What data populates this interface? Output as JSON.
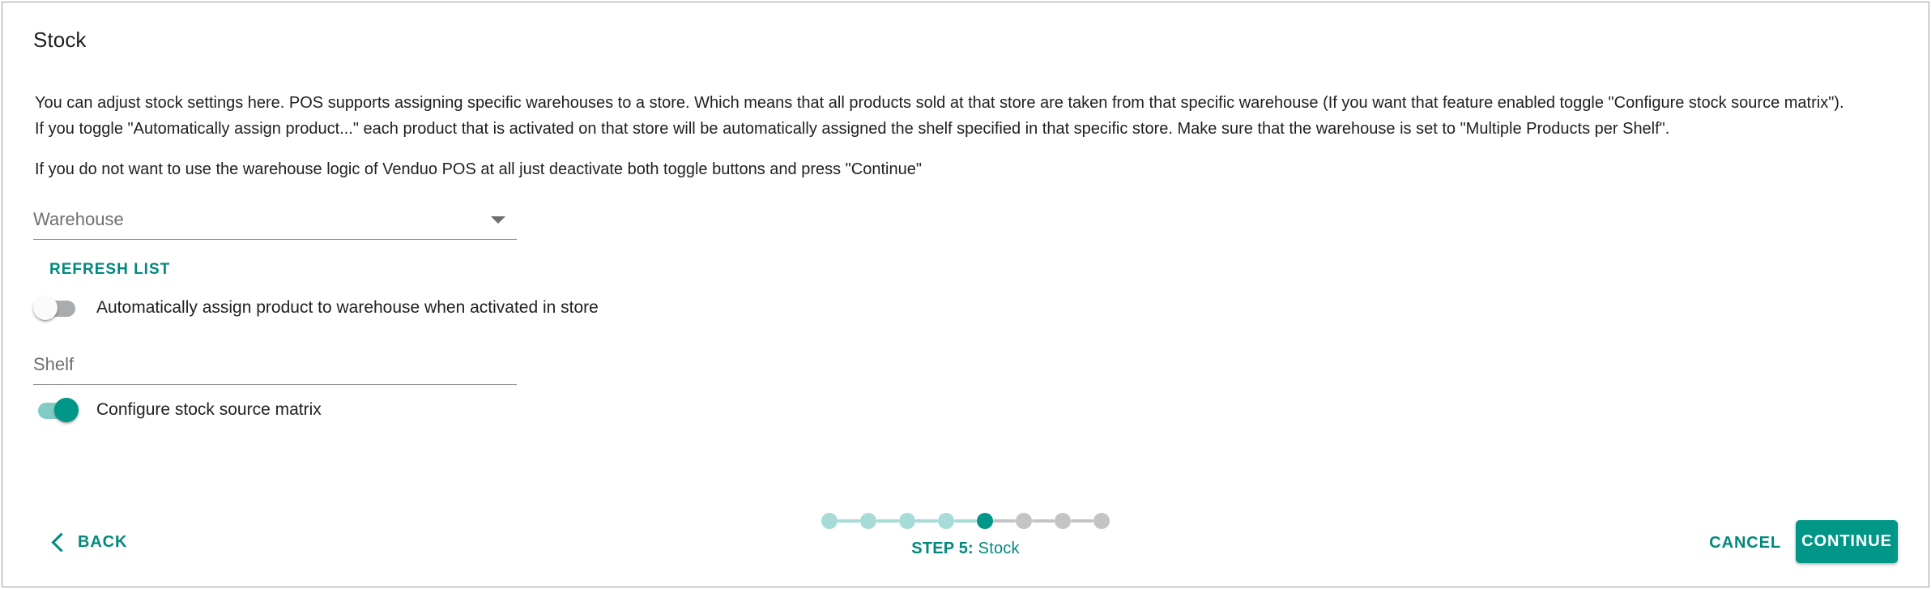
{
  "page": {
    "title": "Stock",
    "description_paragraph_1_line_1": "You can adjust stock settings here. POS supports assigning specific warehouses to a store. Which means that all products sold at that store are taken from that specific warehouse (If you want that feature enabled toggle \"Configure stock source matrix\").",
    "description_paragraph_1_line_2": "If you toggle \"Automatically assign product...\" each product that is activated on that store will be automatically assigned the shelf specified in that specific store. Make sure that the warehouse is set to \"Multiple Products per Shelf\".",
    "description_paragraph_2": "If you do not want to use the warehouse logic of Venduo POS at all just deactivate both toggle buttons and press \"Continue\""
  },
  "form": {
    "warehouse_field": {
      "label": "Warehouse",
      "value": "",
      "icon": "chevron-down-icon"
    },
    "refresh_list_button": "REFRESH LIST",
    "auto_assign_toggle": {
      "label": "Automatically assign product to warehouse when activated in store",
      "state": "off"
    },
    "shelf_field": {
      "label": "Shelf",
      "value": ""
    },
    "stock_source_matrix_toggle": {
      "label": "Configure stock source matrix",
      "state": "on"
    }
  },
  "footer": {
    "back_label": "BACK",
    "back_icon": "chevron-left-icon",
    "cancel_label": "CANCEL",
    "continue_label": "CONTINUE",
    "stepper": {
      "total_steps": 8,
      "current_step": 5,
      "step_prefix": "STEP 5:",
      "step_name": " Stock",
      "dot_states": [
        "done",
        "done",
        "done",
        "done",
        "active",
        "todo",
        "todo",
        "todo"
      ]
    }
  },
  "colors": {
    "accent": "#009688",
    "accent_text": "#00897b",
    "accent_light": "#a7dbd8",
    "toggle_track_on": "#80cbc4",
    "toggle_track_off": "#a8acae",
    "inactive_gray": "#c4c4c4",
    "border": "#9e9e9e",
    "text": "#212121",
    "label_gray": "#6e6e6e"
  }
}
